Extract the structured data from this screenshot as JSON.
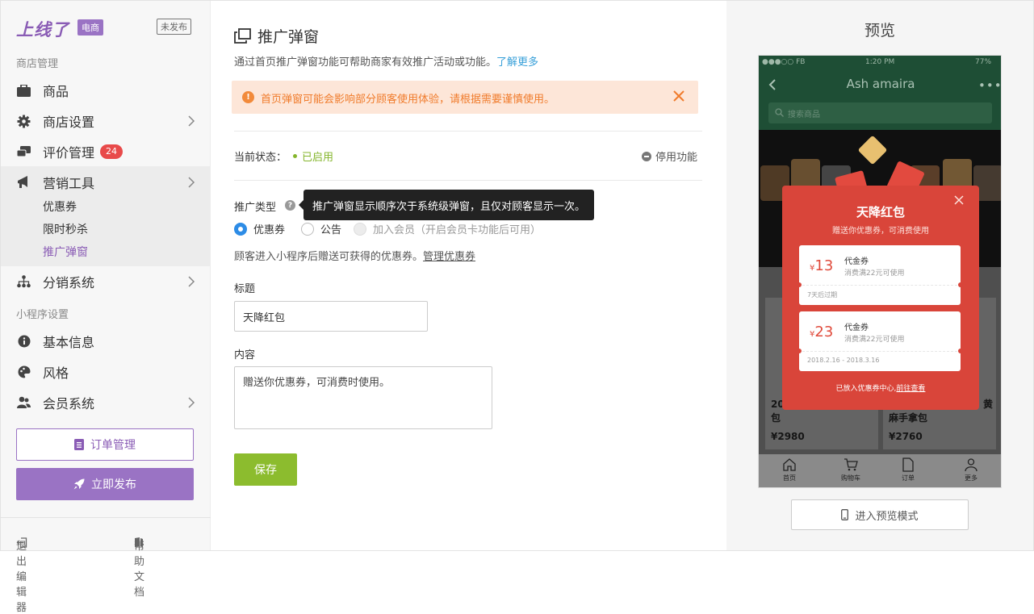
{
  "sidebar": {
    "logo": "上线了",
    "tag": "电商",
    "unpublished": "未发布",
    "section_store": "商店管理",
    "items": [
      {
        "label": "商品"
      },
      {
        "label": "商店设置"
      },
      {
        "label": "评价管理",
        "badge": "24"
      },
      {
        "label": "营销工具"
      }
    ],
    "sub_items": [
      {
        "label": "优惠券"
      },
      {
        "label": "限时秒杀"
      },
      {
        "label": "推广弹窗"
      }
    ],
    "item_distribution": "分销系统",
    "section_miniapp": "小程序设置",
    "items2": [
      {
        "label": "基本信息"
      },
      {
        "label": "风格"
      },
      {
        "label": "会员系统"
      }
    ],
    "order_btn": "订单管理",
    "publish_btn": "立即发布",
    "exit": "退出编辑器",
    "help": "帮助文档"
  },
  "main": {
    "title": "推广弹窗",
    "desc": "通过首页推广弹窗功能可帮助商家有效推广活动或功能。",
    "learn_more": "了解更多",
    "alert": "首页弹窗可能会影响部分顾客使用体验，请根据需要谨慎使用。",
    "status_label": "当前状态：",
    "status_value": "已启用",
    "disable": "停用功能",
    "type_label": "推广类型",
    "tooltip": "推广弹窗显示顺序次于系统级弹窗，且仅对顾客显示一次。",
    "radios": [
      {
        "label": "优惠券",
        "checked": true
      },
      {
        "label": "公告",
        "checked": false
      },
      {
        "label": "加入会员（开启会员卡功能后可用）",
        "checked": false,
        "disabled": true
      }
    ],
    "hint": "顾客进入小程序后赠送可获得的优惠券。",
    "hint_link": "管理优惠券",
    "title_label": "标题",
    "title_value": "天降红包",
    "content_label": "内容",
    "content_value": "赠送你优惠券，可消费时使用。",
    "save": "保存"
  },
  "preview": {
    "title": "预览",
    "statusbar": {
      "carrier": "●●●○○ FB",
      "time": "1:20 PM",
      "battery": "77%"
    },
    "store_name": "Ash amaira",
    "search_placeholder": "搜索商品",
    "products": [
      {
        "name_line1": "20",
        "name_line2": "包",
        "price": "¥2980"
      },
      {
        "name_line1": "黄",
        "name_line2": "麻手拿包",
        "price": "¥2760"
      }
    ],
    "tabs": [
      "首页",
      "购物车",
      "订单",
      "更多"
    ],
    "modal": {
      "title": "天降红包",
      "subtitle": "赠送你优惠券，可消费使用",
      "coupons": [
        {
          "currency": "¥",
          "amount": "13",
          "name": "代金券",
          "condition": "消费满22元可使用",
          "date": "7天后过期"
        },
        {
          "currency": "¥",
          "amount": "23",
          "name": "代金券",
          "condition": "消费满22元可使用",
          "date": "2018.2.16 - 2018.3.16"
        }
      ],
      "footer": "已放入优惠券中心,",
      "footer_link": "前往查看"
    },
    "enter_btn": "进入预览模式"
  },
  "colors": {
    "brand": "#9a73c4",
    "accent_green": "#8cbc2e",
    "alert_bg": "#fde6d8",
    "alert_text": "#f07b2b",
    "link": "#38a0d9",
    "badge": "#e84a4a"
  }
}
